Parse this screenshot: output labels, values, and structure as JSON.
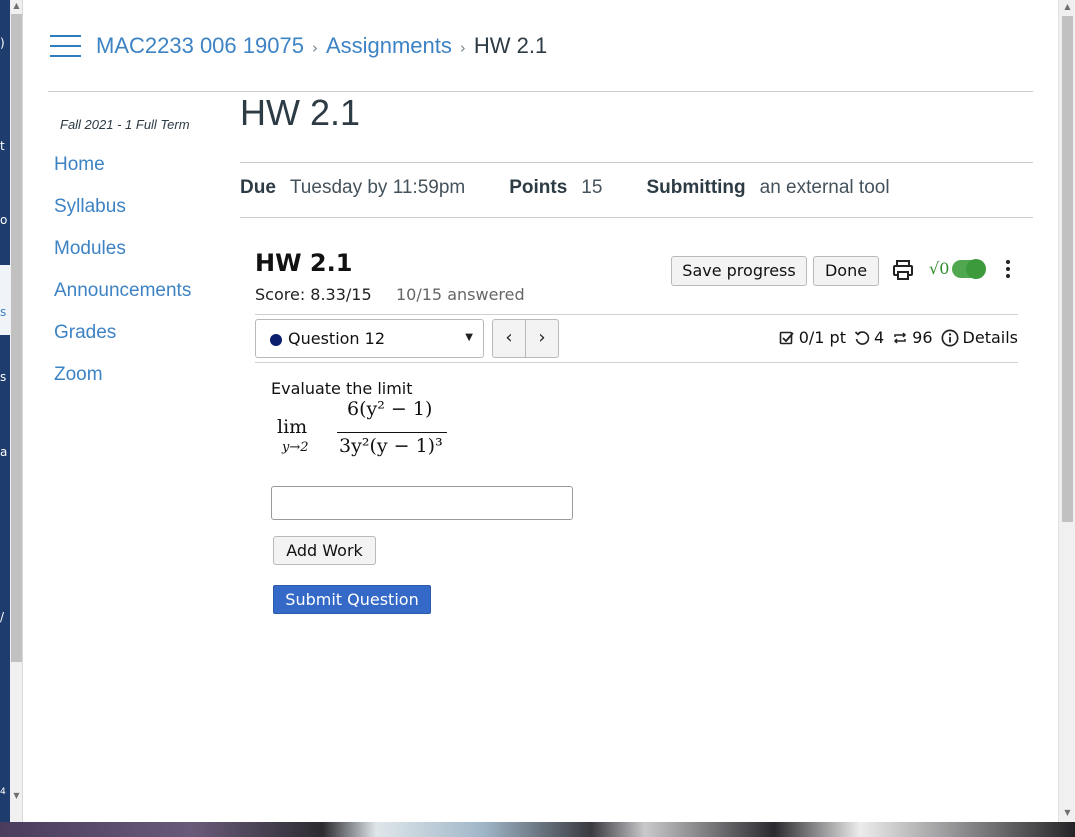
{
  "background_fragments": [
    ")",
    "t",
    "o",
    "s",
    "s",
    "a",
    "/",
    "4"
  ],
  "breadcrumb": {
    "course": "MAC2233 006 19075",
    "section": "Assignments",
    "current": "HW 2.1"
  },
  "sidebar": {
    "term": "Fall 2021 - 1 Full Term",
    "items": [
      {
        "label": "Home"
      },
      {
        "label": "Syllabus"
      },
      {
        "label": "Modules"
      },
      {
        "label": "Announcements"
      },
      {
        "label": "Grades"
      },
      {
        "label": "Zoom"
      }
    ]
  },
  "assignment": {
    "title": "HW 2.1",
    "due_label": "Due",
    "due_value": "Tuesday by 11:59pm",
    "points_label": "Points",
    "points_value": "15",
    "submitting_label": "Submitting",
    "submitting_value": "an external tool"
  },
  "tool": {
    "title": "HW 2.1",
    "score": "Score: 8.33/15",
    "answered": "10/15 answered",
    "save_label": "Save progress",
    "done_label": "Done",
    "question_select": "Question 12",
    "stats": {
      "points": "0/1 pt",
      "retries": "4",
      "versions": "96",
      "details": "Details"
    },
    "prompt": "Evaluate the limit",
    "math": {
      "lim": "lim",
      "sub": "y→2",
      "numerator": "6(y² − 1)",
      "denominator": "3y²(y − 1)³"
    },
    "answer_value": "",
    "add_work_label": "Add Work",
    "submit_label": "Submit Question"
  },
  "colors": {
    "link": "#3d83c4",
    "submit": "#3569c7",
    "toggle": "#4fa84f"
  }
}
